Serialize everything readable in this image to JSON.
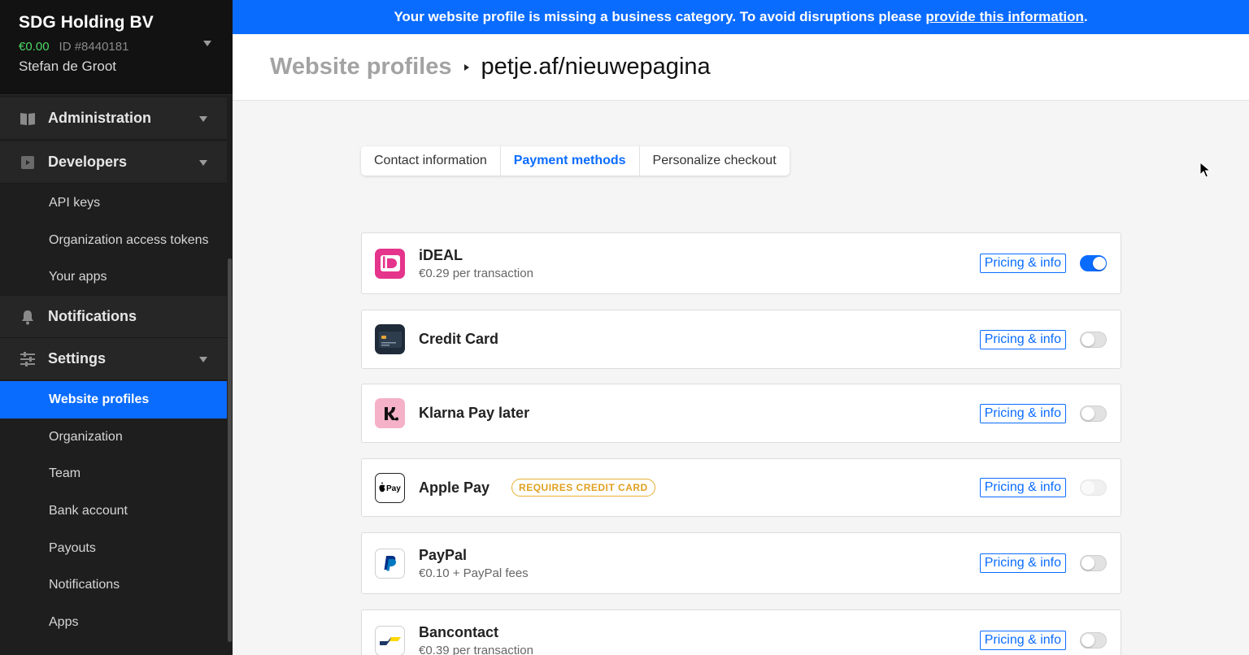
{
  "sidebar": {
    "org_name": "SDG Holding BV",
    "balance": "€0.00",
    "org_id": "ID #8440181",
    "user_name": "Stefan de Groot",
    "sections": [
      {
        "label": "Administration",
        "icon": "book-icon"
      },
      {
        "label": "Developers",
        "icon": "play-icon"
      },
      {
        "label": "Notifications",
        "icon": "bell-icon"
      },
      {
        "label": "Settings",
        "icon": "sliders-icon"
      }
    ],
    "developer_items": [
      "API keys",
      "Organization access tokens",
      "Your apps"
    ],
    "settings_items": [
      "Website profiles",
      "Organization",
      "Team",
      "Bank account",
      "Payouts",
      "Notifications",
      "Apps"
    ],
    "active_item": "Website profiles"
  },
  "banner": {
    "text": "Your website profile is missing a business category. To avoid disruptions please",
    "link": "provide this information",
    "suffix": "."
  },
  "header": {
    "parent": "Website profiles",
    "current": "petje.af/nieuwepagina"
  },
  "tabs": [
    {
      "label": "Contact information",
      "active": false
    },
    {
      "label": "Payment methods",
      "active": true
    },
    {
      "label": "Personalize checkout",
      "active": false
    }
  ],
  "payment_methods": [
    {
      "name": "iDEAL",
      "price": "€0.29 per transaction",
      "pricing_label": "Pricing & info",
      "enabled": true,
      "icon": "ideal-icon"
    },
    {
      "name": "Credit Card",
      "price": "",
      "pricing_label": "Pricing & info",
      "enabled": false,
      "icon": "credit-card-icon"
    },
    {
      "name": "Klarna Pay later",
      "price": "",
      "pricing_label": "Pricing & info",
      "enabled": false,
      "icon": "klarna-icon"
    },
    {
      "name": "Apple Pay",
      "price": "",
      "badge": "REQUIRES CREDIT CARD",
      "pricing_label": "Pricing & info",
      "enabled": false,
      "disabled": true,
      "icon": "apple-pay-icon"
    },
    {
      "name": "PayPal",
      "price": "€0.10 + PayPal fees",
      "pricing_label": "Pricing & info",
      "enabled": false,
      "icon": "paypal-icon"
    },
    {
      "name": "Bancontact",
      "price": "€0.39 per transaction",
      "pricing_label": "Pricing & info",
      "enabled": false,
      "icon": "bancontact-icon"
    }
  ],
  "colors": {
    "accent": "#0a6cff",
    "sidebar_bg": "#1e1e1e",
    "balance": "#4cd964",
    "badge": "#e0a020"
  }
}
